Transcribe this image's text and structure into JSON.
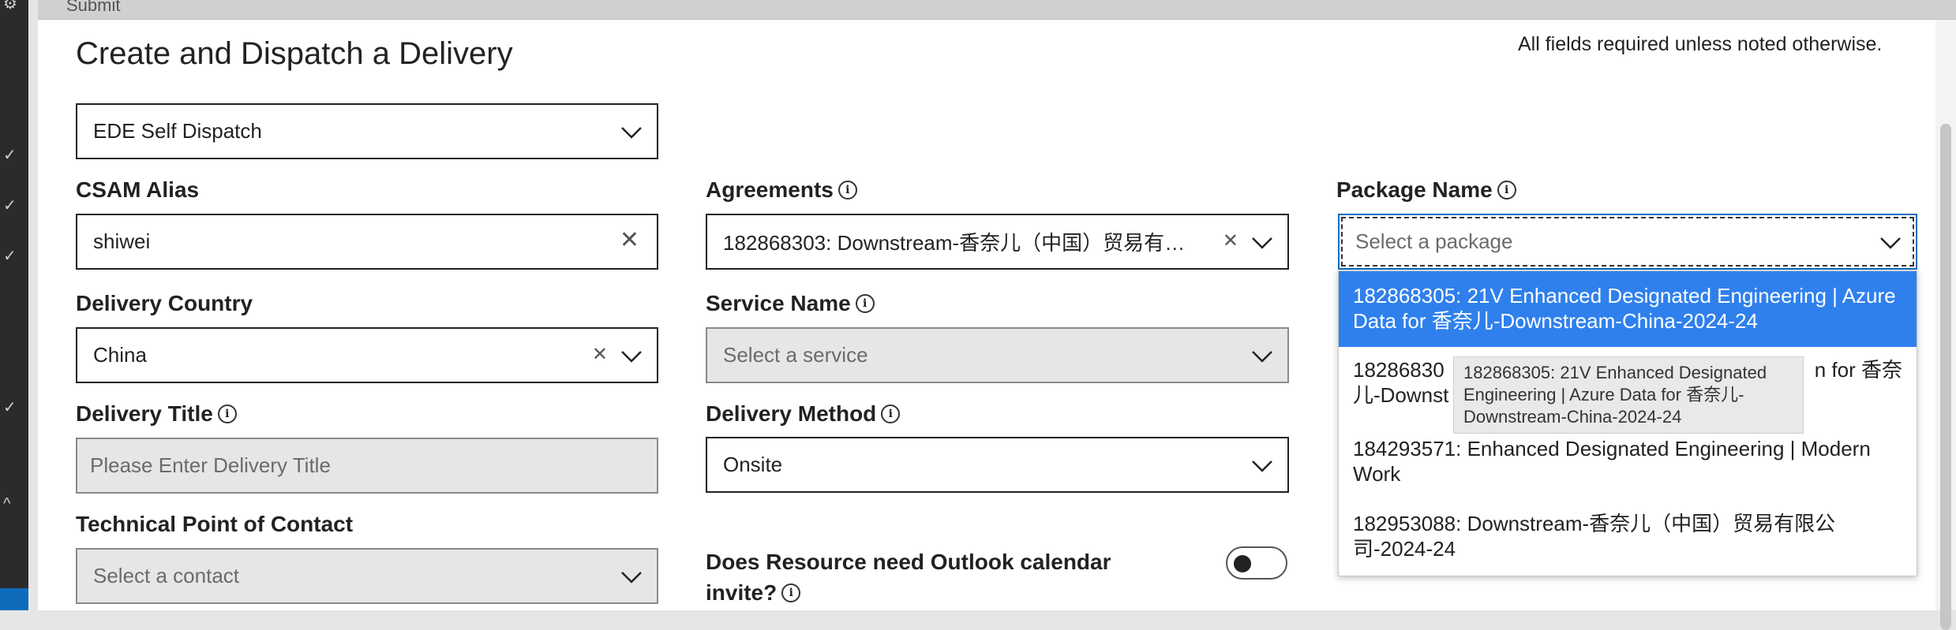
{
  "app": {
    "top_action": "Submit",
    "form_title": "Create and Dispatch a Delivery",
    "required_note": "All fields required unless noted otherwise."
  },
  "dispatch_type": {
    "value": "EDE Self Dispatch"
  },
  "csam_alias": {
    "label": "CSAM Alias",
    "value": "shiwei"
  },
  "agreements": {
    "label": "Agreements",
    "value": "182868303: Downstream-香奈儿（中国）贸易有限公..."
  },
  "package_name": {
    "label": "Package Name",
    "placeholder": "Select a package"
  },
  "delivery_country": {
    "label": "Delivery Country",
    "value": "China"
  },
  "service_name": {
    "label": "Service Name",
    "placeholder": "Select a service"
  },
  "delivery_title": {
    "label": "Delivery Title",
    "placeholder": "Please Enter Delivery Title"
  },
  "delivery_method": {
    "label": "Delivery Method",
    "value": "Onsite"
  },
  "technical_poc": {
    "label": "Technical Point of Contact",
    "placeholder": "Select a contact"
  },
  "outlook_invite": {
    "label_line1": "Does Resource need Outlook calendar",
    "label_line2": "invite?",
    "enabled": false
  },
  "package_options": [
    {
      "line1": "182868305: 21V Enhanced Designated Engineering | Azure",
      "line2": "Data for 香奈儿-Downstream-China-2024-24"
    },
    {
      "line1": "18286830",
      "line1b": "n for 香奈",
      "line2": "儿-Downst"
    },
    {
      "line1": "184293571: Enhanced Designated Engineering | Modern",
      "line2": "Work"
    },
    {
      "line1": "182953088: Downstream-香奈儿（中国）贸易有限公",
      "line2": "司-2024-24"
    }
  ],
  "tooltip": {
    "line1": "182868305: 21V Enhanced Designated",
    "line2": "Engineering | Azure Data for 香奈儿-",
    "line3": "Downstream-China-2024-24"
  },
  "icons": {
    "chevron": "chevron-down-icon",
    "clear": "clear-icon",
    "info": "info-icon"
  }
}
